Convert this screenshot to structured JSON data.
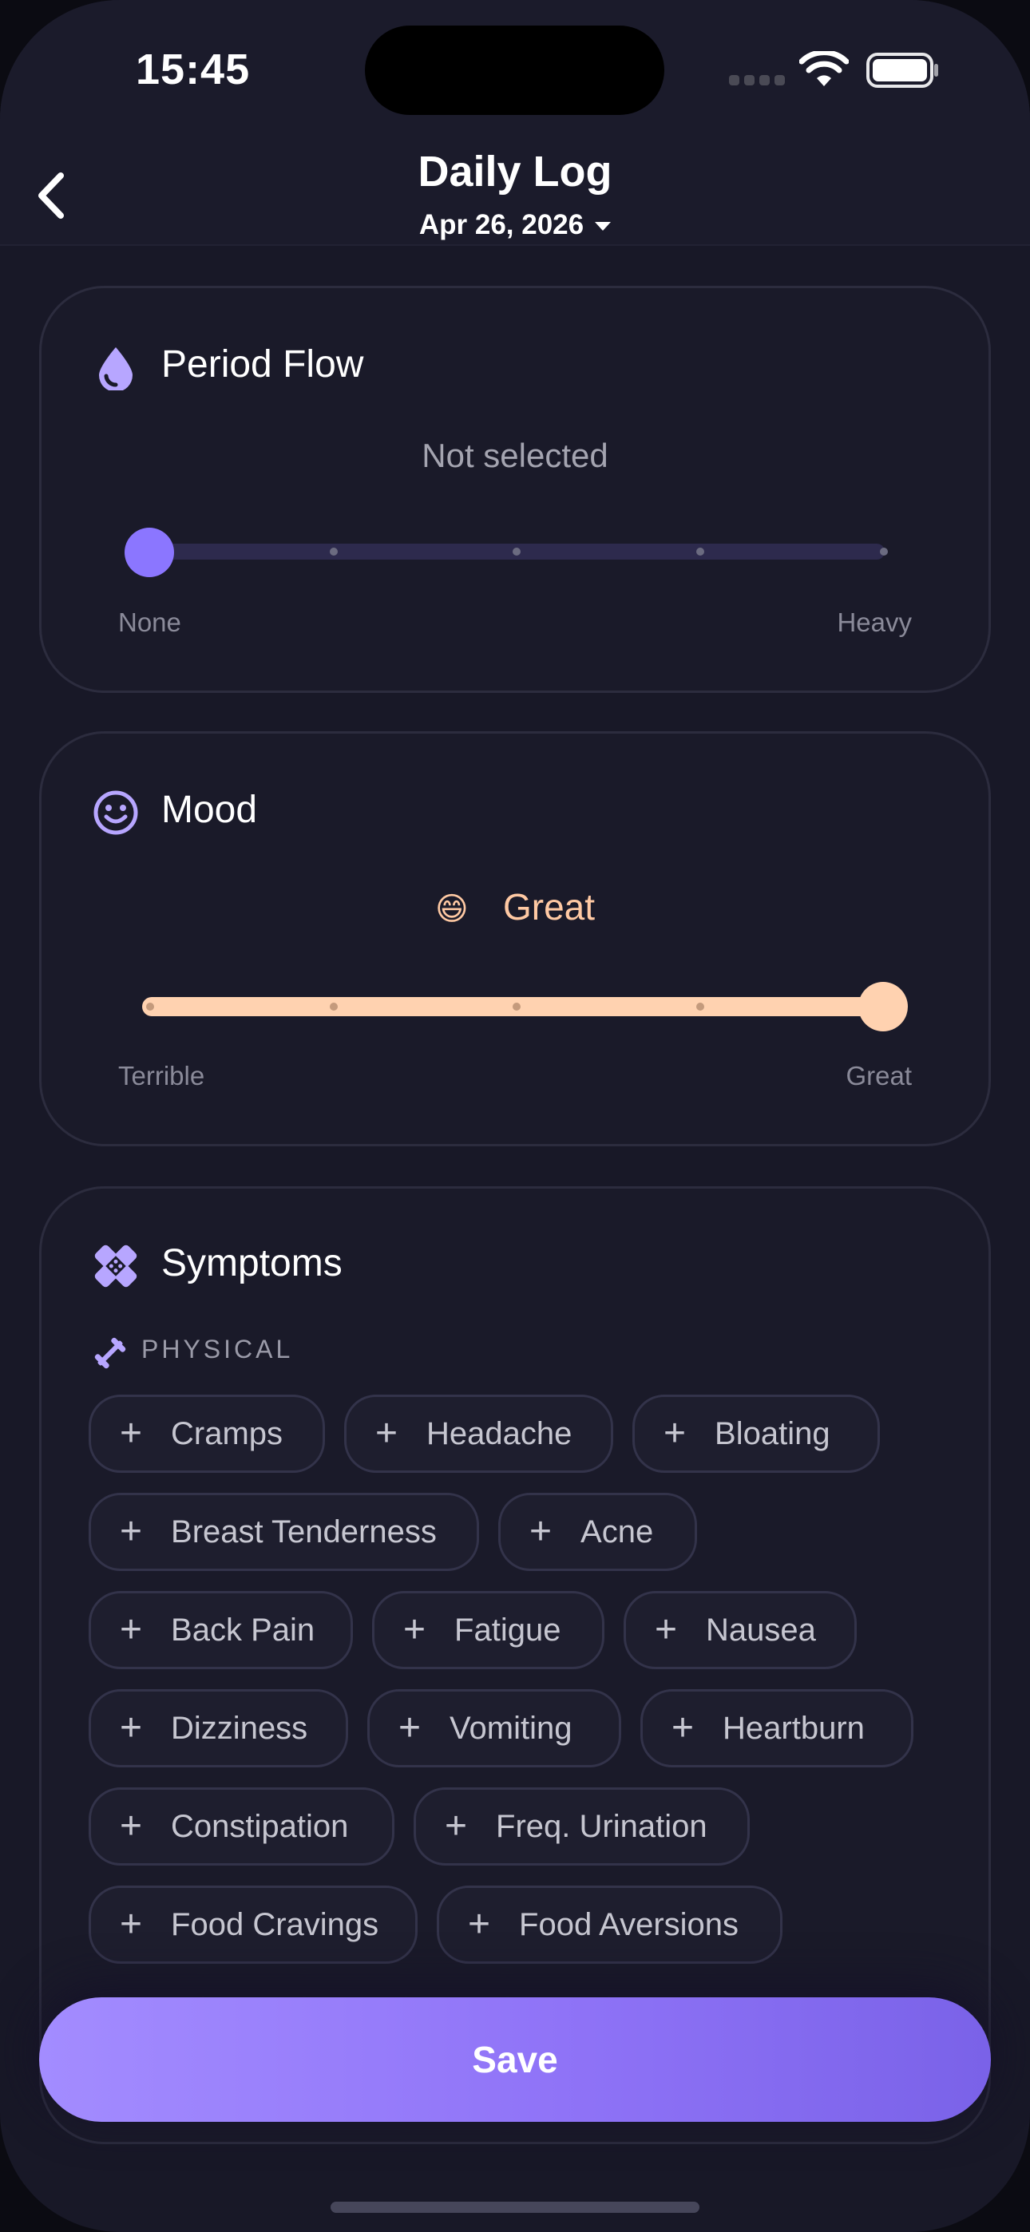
{
  "status_bar": {
    "time": "15:45"
  },
  "nav": {
    "title": "Daily Log",
    "date": "Apr 26, 2026"
  },
  "period_flow": {
    "title": "Period Flow",
    "value_text": "Not selected",
    "min_label": "None",
    "max_label": "Heavy",
    "level": 0,
    "steps": 5,
    "accent": "#8b76ff"
  },
  "mood": {
    "title": "Mood",
    "emoji": "😄",
    "value_text": "Great",
    "min_label": "Terrible",
    "max_label": "Great",
    "level": 4,
    "steps": 5,
    "accent": "#ffd2b0"
  },
  "symptoms": {
    "title": "Symptoms",
    "section_label": "PHYSICAL",
    "chips": [
      "Cramps",
      "Headache",
      "Bloating",
      "Breast Tenderness",
      "Acne",
      "Back Pain",
      "Fatigue",
      "Nausea",
      "Dizziness",
      "Vomiting",
      "Heartburn",
      "Constipation",
      "Freq. Urination",
      "Food Cravings",
      "Food Aversions"
    ]
  },
  "save_button": {
    "label": "Save"
  }
}
